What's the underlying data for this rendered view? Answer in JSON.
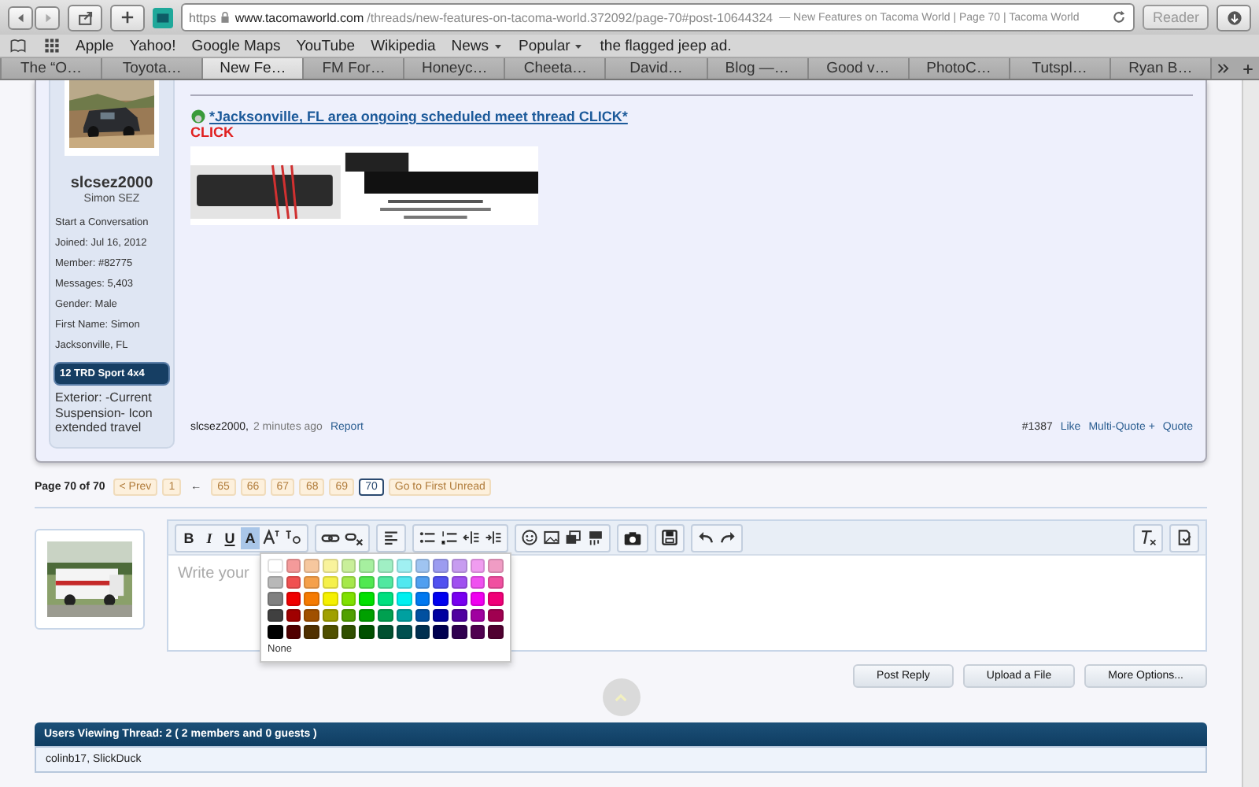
{
  "browser": {
    "address": {
      "scheme": "https",
      "host": "www.tacomaworld.com",
      "path": "/threads/new-features-on-tacoma-world.372092/page-70#post-10644324",
      "title": "— New Features on Tacoma World | Page 70 | Tacoma World"
    },
    "reader": "Reader",
    "bookmarks": [
      {
        "label": "Apple",
        "menu": false
      },
      {
        "label": "Yahoo!",
        "menu": false
      },
      {
        "label": "Google Maps",
        "menu": false
      },
      {
        "label": "YouTube",
        "menu": false
      },
      {
        "label": "Wikipedia",
        "menu": false
      },
      {
        "label": "News",
        "menu": true
      },
      {
        "label": "Popular",
        "menu": true
      },
      {
        "label": "the flagged jeep ad.",
        "menu": false
      }
    ],
    "tabs": [
      {
        "label": "The “O…",
        "selected": false
      },
      {
        "label": "Toyota…",
        "selected": false
      },
      {
        "label": "New Fe…",
        "selected": true
      },
      {
        "label": "FM For…",
        "selected": false
      },
      {
        "label": "Honeyc…",
        "selected": false
      },
      {
        "label": "Cheeta…",
        "selected": false
      },
      {
        "label": "David…",
        "selected": false
      },
      {
        "label": "Blog —…",
        "selected": false
      },
      {
        "label": "Good v…",
        "selected": false
      },
      {
        "label": "PhotoC…",
        "selected": false
      },
      {
        "label": "Tutspl…",
        "selected": false
      },
      {
        "label": "Ryan B…",
        "selected": false
      }
    ]
  },
  "post": {
    "user": {
      "name": "slcsez2000",
      "title": "Simon SEZ",
      "start": "Start a Conversation",
      "info": [
        "Joined:  Jul 16, 2012",
        "Member:  #82775",
        "Messages:  5,403",
        "Gender:  Male",
        "First Name:  Simon",
        "Jacksonville, FL"
      ],
      "badge": "12 TRD Sport 4x4",
      "custom": "Exterior: -Current Suspension- Icon extended travel"
    },
    "link": "*Jacksonville, FL area ongoing scheduled meet thread CLICK*",
    "click": "CLICK",
    "author": "slcsez2000,",
    "time": "2 minutes ago",
    "report": "Report",
    "number": "#1387",
    "actions": [
      "Like",
      "Multi-Quote +",
      "Quote"
    ]
  },
  "pagination": {
    "summary": "Page 70 of 70",
    "items": [
      {
        "kind": "link",
        "label": "< Prev"
      },
      {
        "kind": "page",
        "label": "1",
        "selected": false
      },
      {
        "kind": "gap",
        "label": "←"
      },
      {
        "kind": "page",
        "label": "65",
        "selected": false
      },
      {
        "kind": "page",
        "label": "66",
        "selected": false
      },
      {
        "kind": "page",
        "label": "67",
        "selected": false
      },
      {
        "kind": "page",
        "label": "68",
        "selected": false
      },
      {
        "kind": "page",
        "label": "69",
        "selected": false
      },
      {
        "kind": "page",
        "label": "70",
        "selected": true
      },
      {
        "kind": "link",
        "label": "Go to First Unread"
      }
    ]
  },
  "editor": {
    "format_buttons": [
      {
        "label": "B",
        "selected": false
      },
      {
        "label": "I",
        "selected": false
      },
      {
        "label": "U",
        "selected": false
      },
      {
        "label": "A",
        "selected": true
      }
    ],
    "placeholder": "Write your",
    "color_picker": {
      "rows": [
        [
          {
            "color": "#ffffff"
          },
          {
            "color": "#f49a9a"
          },
          {
            "color": "#f6c79e"
          },
          {
            "color": "#f9f39c"
          },
          {
            "color": "#c9ef9a"
          },
          {
            "color": "#a6ef9f"
          },
          {
            "color": "#a0efc4"
          },
          {
            "color": "#a0f0f2"
          },
          {
            "color": "#9fc4f1"
          },
          {
            "color": "#9c9cf0"
          },
          {
            "color": "#c79cf0"
          },
          {
            "color": "#f09cf0"
          },
          {
            "color": "#f09cc4"
          }
        ],
        [
          {
            "color": "#b8b8b8"
          },
          {
            "color": "#f05050"
          },
          {
            "color": "#f5a04a"
          },
          {
            "color": "#f5f04a"
          },
          {
            "color": "#a5e84a"
          },
          {
            "color": "#50e850"
          },
          {
            "color": "#50e8a0"
          },
          {
            "color": "#50e8f0"
          },
          {
            "color": "#509ff0"
          },
          {
            "color": "#5050f0"
          },
          {
            "color": "#a050f0"
          },
          {
            "color": "#f050f0"
          },
          {
            "color": "#f050a0"
          }
        ],
        [
          {
            "color": "#808080"
          },
          {
            "color": "#f00000"
          },
          {
            "color": "#f57a00"
          },
          {
            "color": "#f5f000"
          },
          {
            "color": "#7fe000"
          },
          {
            "color": "#00e000"
          },
          {
            "color": "#00e07f"
          },
          {
            "color": "#00f0f0"
          },
          {
            "color": "#0078f0"
          },
          {
            "color": "#0000f0"
          },
          {
            "color": "#7800f0"
          },
          {
            "color": "#f000f0"
          },
          {
            "color": "#f00078"
          }
        ],
        [
          {
            "color": "#404040"
          },
          {
            "color": "#a00000"
          },
          {
            "color": "#a05000"
          },
          {
            "color": "#a0a000"
          },
          {
            "color": "#50a000"
          },
          {
            "color": "#00a000"
          },
          {
            "color": "#00a050"
          },
          {
            "color": "#00a0a0"
          },
          {
            "color": "#0050a0"
          },
          {
            "color": "#0000a0"
          },
          {
            "color": "#5000a0"
          },
          {
            "color": "#a000a0"
          },
          {
            "color": "#a00050"
          }
        ],
        [
          {
            "color": "#000000"
          },
          {
            "color": "#500000"
          },
          {
            "color": "#503000"
          },
          {
            "color": "#505000"
          },
          {
            "color": "#305000"
          },
          {
            "color": "#005000"
          },
          {
            "color": "#005030"
          },
          {
            "color": "#005050"
          },
          {
            "color": "#003050"
          },
          {
            "color": "#000050"
          },
          {
            "color": "#300050"
          },
          {
            "color": "#500050"
          },
          {
            "color": "#500030"
          }
        ]
      ],
      "none": "None"
    }
  },
  "buttons": [
    "Post Reply",
    "Upload a File",
    "More Options..."
  ],
  "viewers": {
    "title": "Users Viewing Thread: 2 ( 2 members and 0 guests )",
    "names": "colinb17, SlickDuck"
  }
}
